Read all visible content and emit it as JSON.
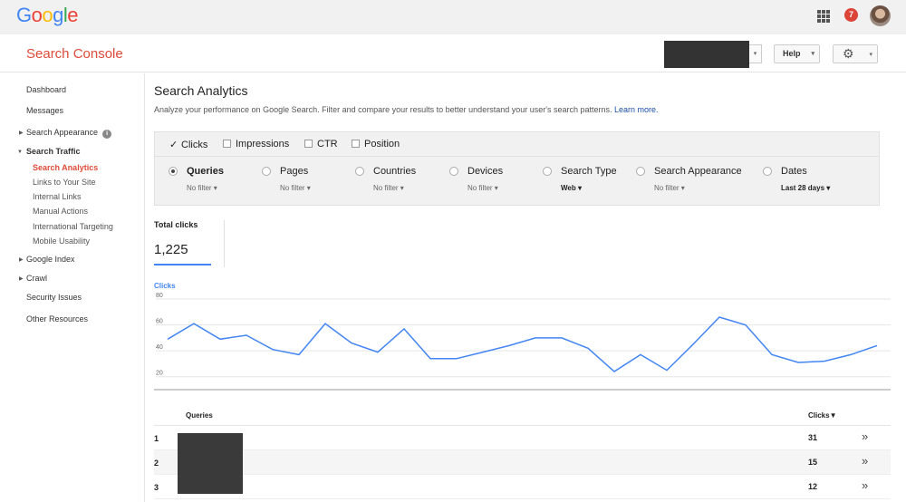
{
  "topbar": {
    "logo_letters": [
      {
        "ch": "G",
        "color": "#4285f4"
      },
      {
        "ch": "o",
        "color": "#ea4335"
      },
      {
        "ch": "o",
        "color": "#fbbc05"
      },
      {
        "ch": "g",
        "color": "#4285f4"
      },
      {
        "ch": "l",
        "color": "#34a853"
      },
      {
        "ch": "e",
        "color": "#ea4335"
      }
    ],
    "notification_count": "7",
    "apps_icon": "grid-icon"
  },
  "header": {
    "product_name": "Search Console",
    "help_label": "Help",
    "settings_icon": "gear-icon",
    "caret": "▾"
  },
  "sidebar": {
    "dashboard": "Dashboard",
    "messages": "Messages",
    "search_appearance": "Search Appearance",
    "search_traffic": "Search Traffic",
    "search_analytics": "Search Analytics",
    "links_to_site": "Links to Your Site",
    "internal_links": "Internal Links",
    "manual_actions": "Manual Actions",
    "international_targeting": "International Targeting",
    "mobile_usability": "Mobile Usability",
    "google_index": "Google Index",
    "crawl": "Crawl",
    "security_issues": "Security Issues",
    "other_resources": "Other Resources"
  },
  "main": {
    "title": "Search Analytics",
    "description": "Analyze your performance on Google Search. Filter and compare your results to better understand your user's search patterns.",
    "learn_more": "Learn more.",
    "metrics": {
      "clicks": "Clicks",
      "impressions": "Impressions",
      "ctr": "CTR",
      "position": "Position"
    },
    "filters": {
      "queries": {
        "label": "Queries",
        "value": "No filter ▾"
      },
      "pages": {
        "label": "Pages",
        "value": "No filter ▾"
      },
      "countries": {
        "label": "Countries",
        "value": "No filter ▾"
      },
      "devices": {
        "label": "Devices",
        "value": "No filter ▾"
      },
      "search_type": {
        "label": "Search Type",
        "value": "Web ▾"
      },
      "search_appearance": {
        "label": "Search Appearance",
        "value": "No filter ▾"
      },
      "dates": {
        "label": "Dates",
        "value": "Last 28 days ▾"
      }
    },
    "total_clicks_label": "Total clicks",
    "total_clicks_value": "1,225",
    "chart_legend": "Clicks"
  },
  "chart_data": {
    "type": "line",
    "series": [
      {
        "name": "Clicks",
        "values": [
          49,
          61,
          49,
          52,
          41,
          37,
          61,
          46,
          39,
          57,
          34,
          34,
          39,
          44,
          50,
          50,
          42,
          24,
          37,
          25,
          45,
          66,
          60,
          37,
          31,
          32,
          37,
          44
        ]
      }
    ],
    "y_ticks": [
      "80",
      "60",
      "40",
      "20"
    ],
    "ylim": [
      10,
      80
    ],
    "grid": true,
    "color": "#4285f4"
  },
  "table": {
    "col_query": "Queries",
    "col_clicks": "Clicks▼",
    "rows": [
      {
        "rank": "1",
        "clicks": "31"
      },
      {
        "rank": "2",
        "clicks": "15"
      },
      {
        "rank": "3",
        "clicks": "12"
      }
    ],
    "row_action": "»"
  }
}
